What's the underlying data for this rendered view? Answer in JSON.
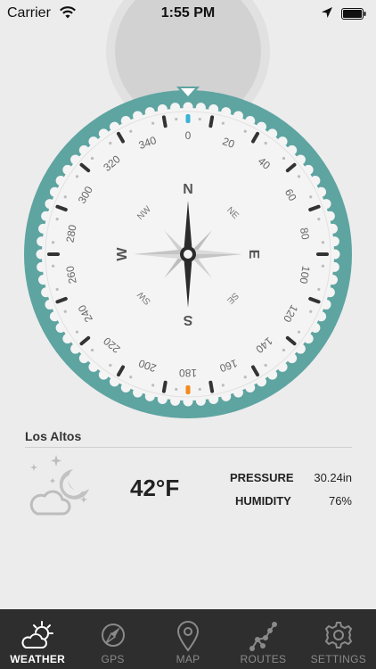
{
  "status_bar": {
    "carrier": "Carrier",
    "time": "1:55 PM"
  },
  "compass": {
    "cardinals": {
      "n": "N",
      "e": "E",
      "s": "S",
      "w": "W"
    },
    "intercardinals": {
      "ne": "NE",
      "se": "SE",
      "sw": "SW",
      "nw": "NW"
    },
    "degree_labels": [
      "0",
      "20",
      "40",
      "60",
      "80",
      "100",
      "120",
      "140",
      "160",
      "180",
      "200",
      "220",
      "240",
      "260",
      "280",
      "300",
      "320",
      "340"
    ],
    "heading_degrees": 0,
    "colors": {
      "ring": "#5ea4a1",
      "north_marker": "#3bb3d8",
      "south_marker": "#f28a1c"
    }
  },
  "weather": {
    "city": "Los Altos",
    "temperature": "42°F",
    "condition_icon": "night-partly-cloudy-icon",
    "pressure_label": "PRESSURE",
    "pressure_value": "30.24in",
    "humidity_label": "HUMIDITY",
    "humidity_value": "76%"
  },
  "tabbar": {
    "tabs": [
      {
        "label": "WEATHER",
        "icon": "weather-icon",
        "active": true
      },
      {
        "label": "GPS",
        "icon": "gps-icon",
        "active": false
      },
      {
        "label": "MAP",
        "icon": "map-pin-icon",
        "active": false
      },
      {
        "label": "ROUTES",
        "icon": "routes-icon",
        "active": false
      },
      {
        "label": "SETTINGS",
        "icon": "gear-icon",
        "active": false
      }
    ]
  }
}
